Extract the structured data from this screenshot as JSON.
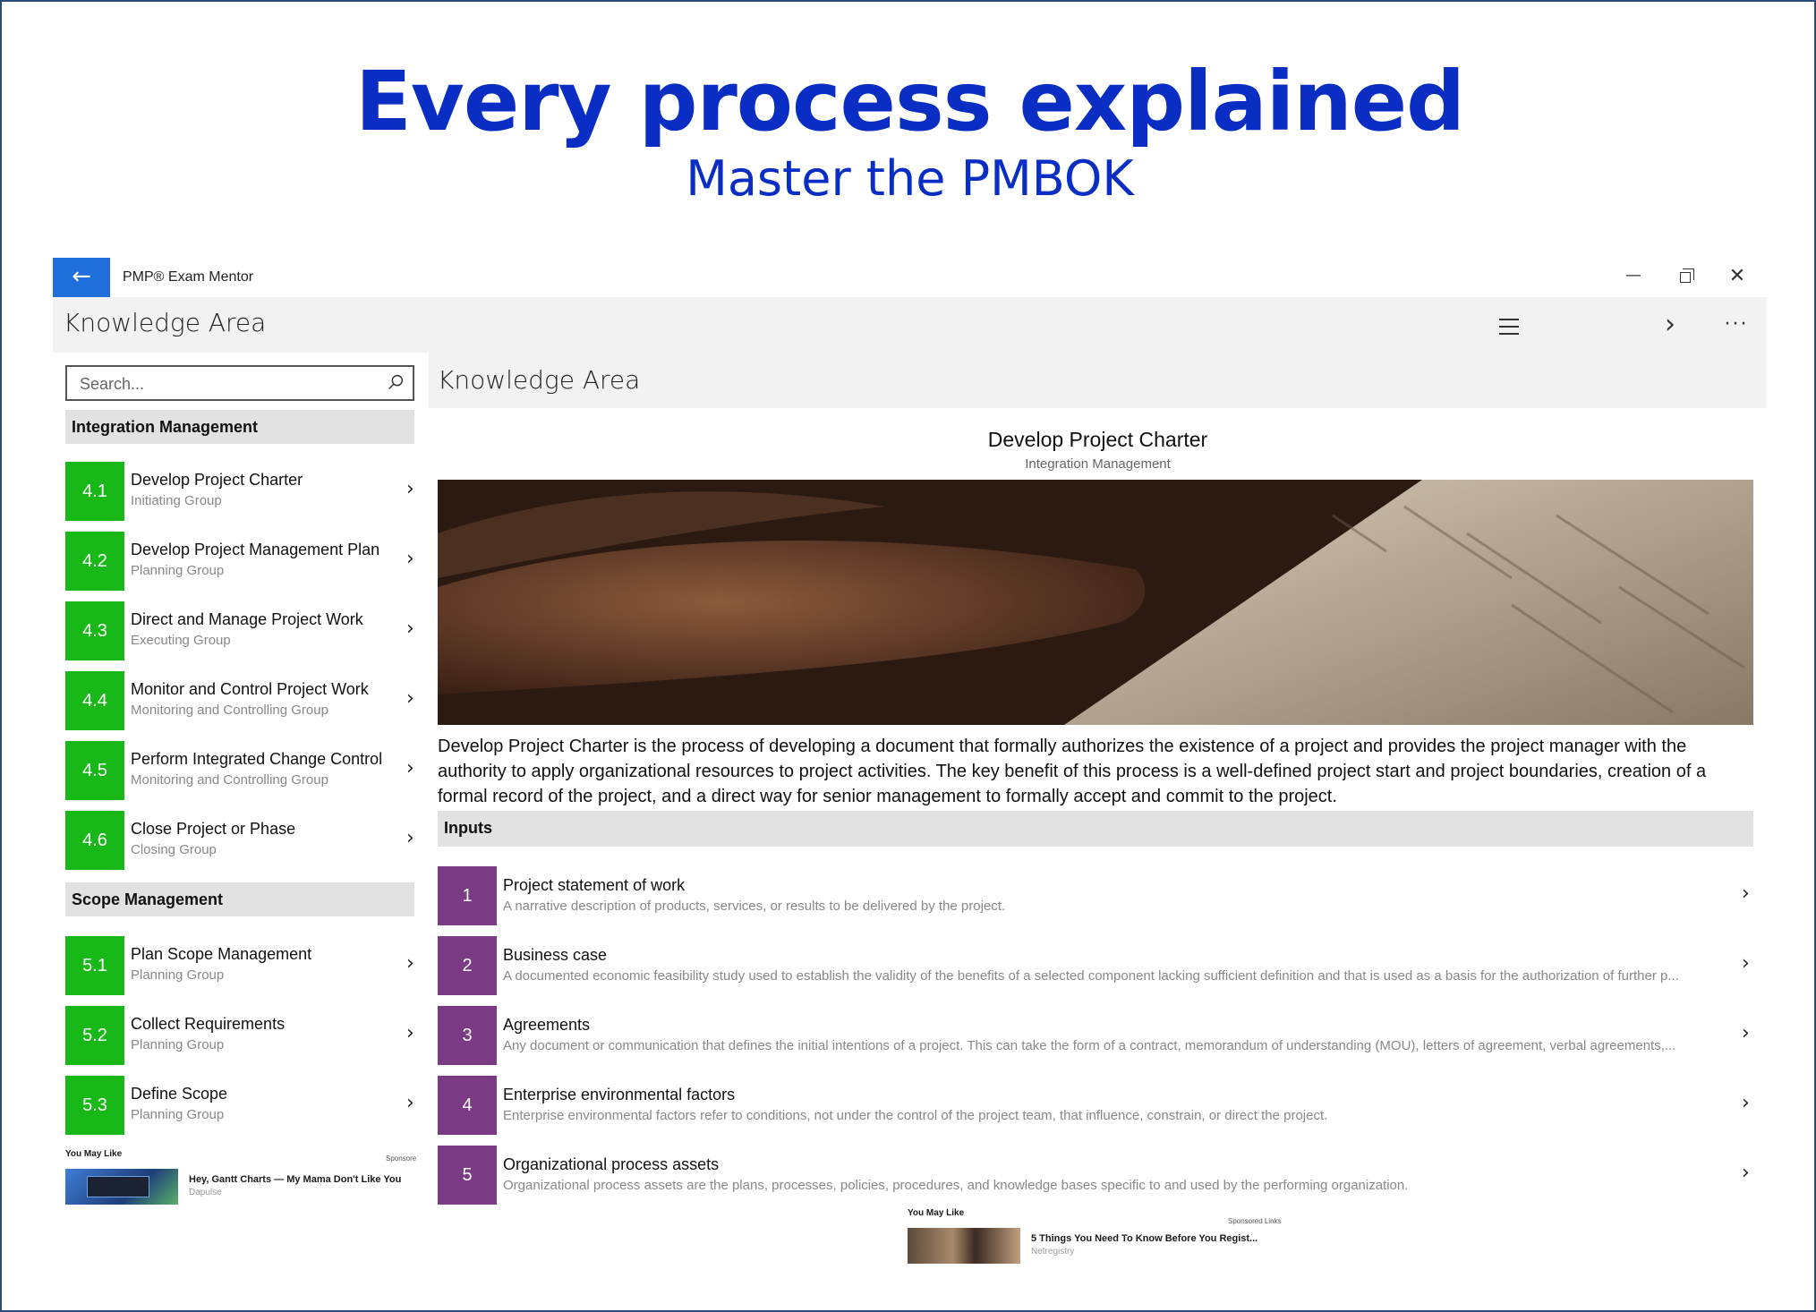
{
  "hero": {
    "title": "Every process explained",
    "subtitle": "Master the PMBOK"
  },
  "window": {
    "app_name": "PMP® Exam Mentor",
    "back_glyph": "←",
    "minimize_glyph": "—",
    "close_glyph": "✕"
  },
  "appbar": {
    "title": "Knowledge Area",
    "next_glyph": "›",
    "more_glyph": "···"
  },
  "search": {
    "placeholder": "Search..."
  },
  "groups": [
    {
      "name": "Integration Management",
      "items": [
        {
          "num": "4.1",
          "title": "Develop Project Charter",
          "group": "Initiating Group"
        },
        {
          "num": "4.2",
          "title": "Develop Project Management Plan",
          "group": "Planning Group"
        },
        {
          "num": "4.3",
          "title": "Direct and Manage Project Work",
          "group": "Executing Group"
        },
        {
          "num": "4.4",
          "title": "Monitor and Control Project Work",
          "group": "Monitoring and Controlling Group"
        },
        {
          "num": "4.5",
          "title": "Perform Integrated Change Control",
          "group": "Monitoring and Controlling Group"
        },
        {
          "num": "4.6",
          "title": "Close Project or Phase",
          "group": "Closing Group"
        }
      ]
    },
    {
      "name": "Scope Management",
      "items": [
        {
          "num": "5.1",
          "title": "Plan Scope Management",
          "group": "Planning Group"
        },
        {
          "num": "5.2",
          "title": "Collect Requirements",
          "group": "Planning Group"
        },
        {
          "num": "5.3",
          "title": "Define Scope",
          "group": "Planning Group"
        }
      ]
    }
  ],
  "chevron": "›",
  "ad_left": {
    "label": "You May Like",
    "sponsored": "Sponsore",
    "headline": "Hey, Gantt Charts — My Mama Don't Like You",
    "source": "Dapulse"
  },
  "detail": {
    "header": "Knowledge Area",
    "title": "Develop Project Charter",
    "subtitle": "Integration Management",
    "description": "Develop Project Charter is the process of developing a document that formally authorizes the existence of a project and provides the project manager with the authority to apply organizational resources to project activities. The key benefit of this process is a well-defined project start and project boundaries, creation of a formal record of the project, and a direct way for senior management to formally accept and commit to the project.",
    "inputs_label": "Inputs",
    "inputs": [
      {
        "num": "1",
        "title": "Project statement of work",
        "desc": "A narrative description of products, services, or results to be delivered by the project."
      },
      {
        "num": "2",
        "title": "Business case",
        "desc": "A documented economic feasibility study used to establish the validity of the benefits of a selected component lacking sufficient definition and that is used as a basis for the authorization of further p..."
      },
      {
        "num": "3",
        "title": "Agreements",
        "desc": "Any document or communication that defines the initial intentions of a project. This can take the form of a contract, memorandum of understanding (MOU), letters of agreement, verbal agreements,..."
      },
      {
        "num": "4",
        "title": "Enterprise environmental factors",
        "desc": "Enterprise environmental factors refer to conditions, not under the control of the project team, that influence, constrain, or direct the project."
      },
      {
        "num": "5",
        "title": "Organizational process assets",
        "desc": "Organizational process assets are the plans, processes, policies, procedures, and knowledge bases specific to and used by the performing organization."
      }
    ]
  },
  "ad_right": {
    "label": "You May Like",
    "sponsored": "Sponsored Links",
    "headline": "5 Things You Need To Know Before You Regist...",
    "source": "Netregistry"
  },
  "colors": {
    "hero_text": "#0a2ec4",
    "back_button": "#1e6fd9",
    "process_badge": "#18b818",
    "input_badge": "#7b3a84"
  }
}
